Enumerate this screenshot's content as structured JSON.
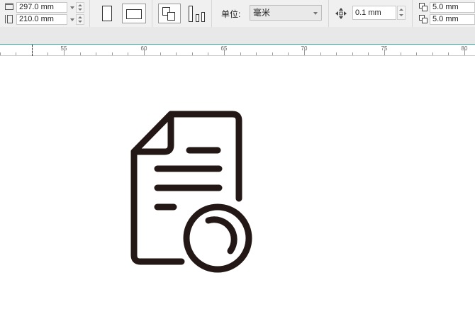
{
  "property_bar": {
    "page_width": "297.0 mm",
    "page_height": "210.0 mm",
    "units_label": "单位:",
    "units_value": "毫米",
    "nudge_value": "0.1 mm",
    "duplicate_x": "5.0 mm",
    "duplicate_y": "5.0 mm"
  },
  "ruler": {
    "labels": [
      "55",
      "60",
      "65",
      "70",
      "75",
      "80"
    ]
  },
  "drawing": {
    "name": "document-search-icon",
    "stroke_color": "#231815"
  },
  "colors": {
    "ruler_accent": "#3fb8ae",
    "toolbar_bg": "#f0f0f0"
  }
}
